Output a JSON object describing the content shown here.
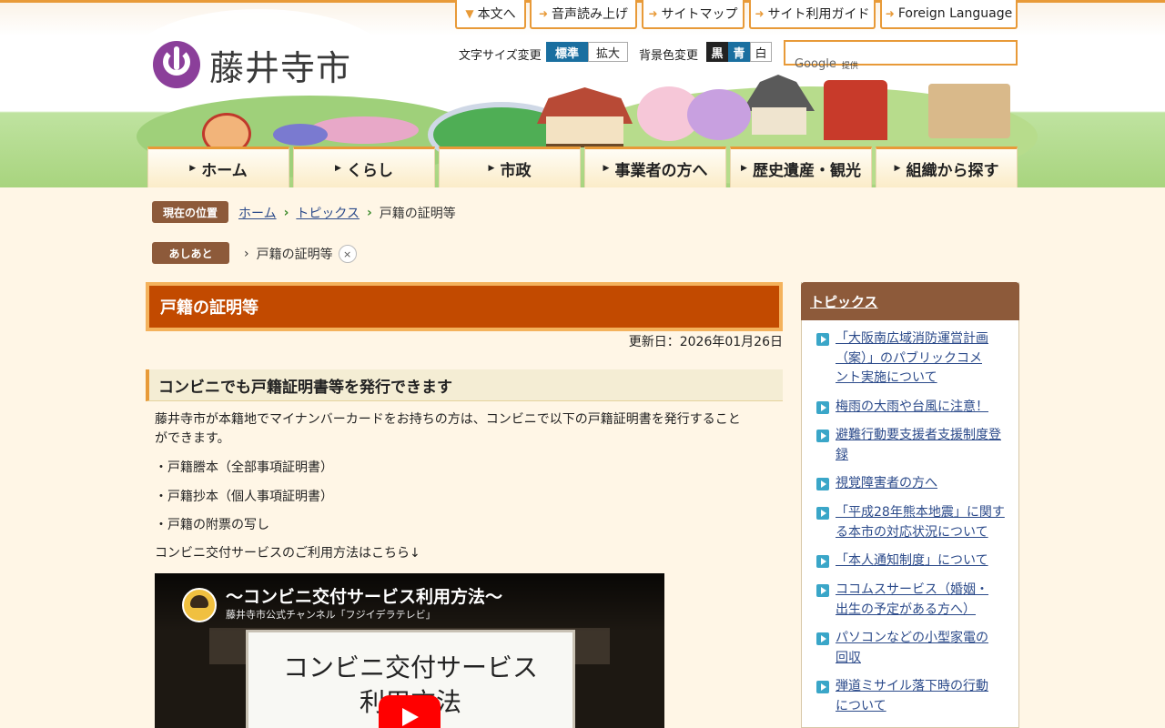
{
  "site": {
    "name": "藤井寺市"
  },
  "top_links": [
    "本文へ",
    "音声読み上げ",
    "サイトマップ",
    "サイト利用ガイド",
    "Foreign Language"
  ],
  "tools": {
    "font_size_label": "文字サイズ変更",
    "font_size_options": [
      "標準",
      "拡大"
    ],
    "bg_color_label": "背景色変更",
    "bg_color_options": [
      "黒",
      "青",
      "白"
    ]
  },
  "search": {
    "brand": "Google",
    "provided": "提供"
  },
  "global_nav": [
    "ホーム",
    "くらし",
    "市政",
    "事業者の方へ",
    "歴史遺産・観光",
    "組織から探す"
  ],
  "breadcrumb": {
    "label": "現在の位置",
    "items": [
      "ホーム",
      "トピックス",
      "戸籍の証明等"
    ]
  },
  "footprint": {
    "label": "あしあと",
    "items": [
      "戸籍の証明等"
    ],
    "remove_glyph": "×"
  },
  "main": {
    "title": "戸籍の証明等",
    "updated": "更新日：2026年01月26日",
    "heading": "コンビニでも戸籍証明書等を発行できます",
    "intro_line1": "藤井寺市が本籍地でマイナンバーカードをお持ちの方は、コンビニで以下の戸籍証明書を発行すること",
    "intro_line2": "ができます。",
    "list": [
      "・戸籍謄本（全部事項証明書）",
      "・戸籍抄本（個人事項証明書）",
      "・戸籍の附票の写し"
    ],
    "howto": "コンビニ交付サービスのご利用方法はこちら↓",
    "video": {
      "title": "～コンビニ交付サービス利用方法～",
      "channel": "藤井寺市公式チャンネル「フジイデラテレビ」",
      "board_line1": "コンビニ交付サービス",
      "board_line2": "利用方法"
    }
  },
  "side": {
    "title": "トピックス",
    "items": [
      [
        "「大阪南広域消防運営計画",
        "（案）」のパブリックコメ",
        "ント実施について"
      ],
      [
        "梅雨の大雨や台風に注意！"
      ],
      [
        "避難行動要支援者支援制度登",
        "録"
      ],
      [
        "視覚障害者の方へ"
      ],
      [
        "「平成28年熊本地震」に関す",
        "る本市の対応状況について"
      ],
      [
        "「本人通知制度」について"
      ],
      [
        "ココムスサービス（婚姻・",
        "出生の予定がある方へ）"
      ],
      [
        "パソコンなどの小型家電の",
        "回収"
      ],
      [
        "弾道ミサイル落下時の行動",
        "について"
      ]
    ]
  },
  "colors": {
    "accent_orange": "#e89a38",
    "title_bg": "#c24a00",
    "brown": "#8d5a3a",
    "logo_purple": "#8b3f9a",
    "link": "#2b4a8a",
    "fontsize_active": "#1a6fa0",
    "bg_black": "#222222",
    "bg_blue": "#1a6fa0"
  },
  "icons": [
    "down-arrow-icon",
    "arrow-right-icon",
    "close-icon",
    "play-icon",
    "list-arrow-icon",
    "city-logo-icon"
  ]
}
